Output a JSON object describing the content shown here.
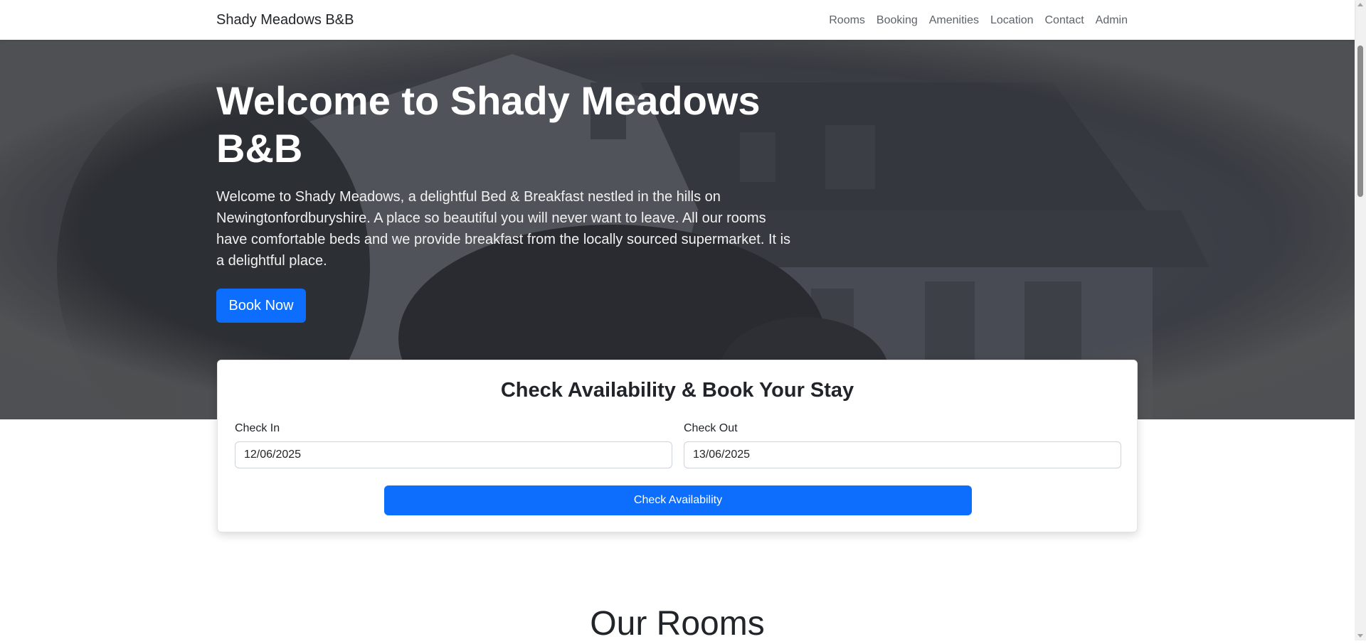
{
  "navbar": {
    "brand": "Shady Meadows B&B",
    "links": [
      "Rooms",
      "Booking",
      "Amenities",
      "Location",
      "Contact",
      "Admin"
    ]
  },
  "hero": {
    "title": "Welcome to Shady Meadows B&B",
    "text": "Welcome to Shady Meadows, a delightful Bed & Breakfast nestled in the hills on Newingtonfordburyshire. A place so beautiful you will never want to leave. All our rooms have comfortable beds and we provide breakfast from the locally sourced supermarket. It is a delightful place.",
    "cta": "Book Now"
  },
  "booking": {
    "title": "Check Availability & Book Your Stay",
    "check_in_label": "Check In",
    "check_in_value": "12/06/2025",
    "check_out_label": "Check Out",
    "check_out_value": "13/06/2025",
    "button": "Check Availability"
  },
  "rooms": {
    "heading": "Our Rooms"
  },
  "colors": {
    "primary": "#0d6efd",
    "hero_overlay": "#4c4f57"
  }
}
